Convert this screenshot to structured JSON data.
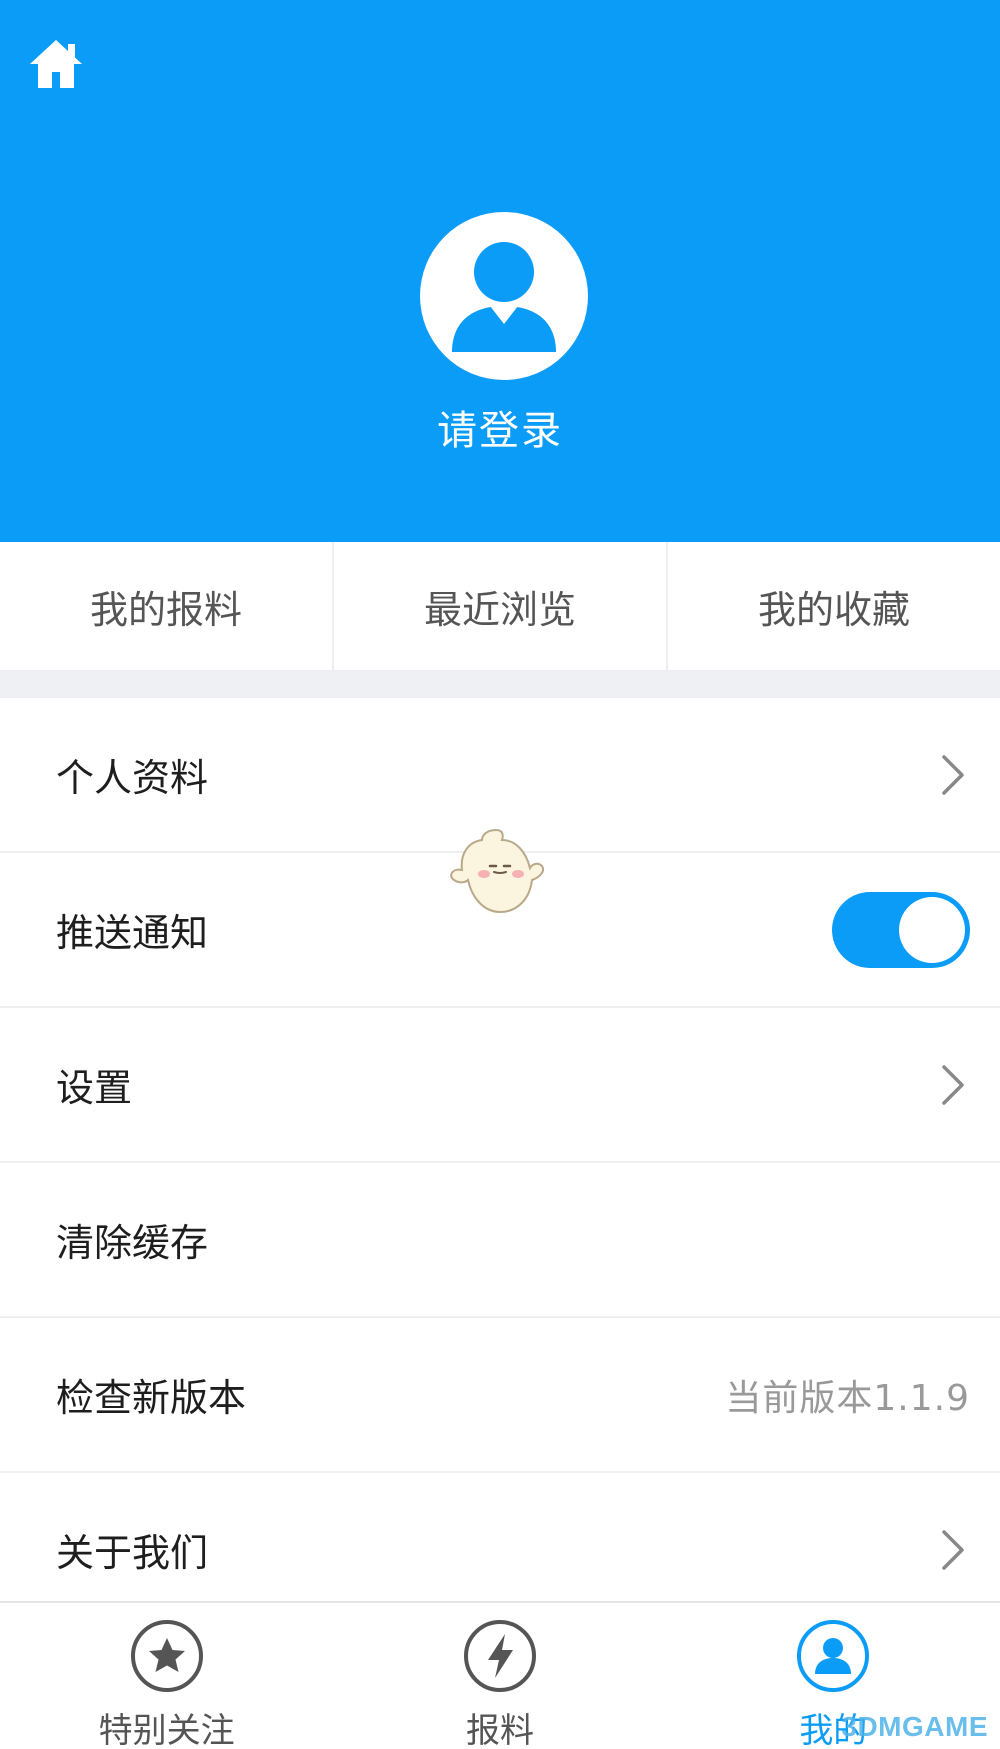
{
  "header": {
    "login_text": "请登录",
    "home_icon": "home-icon",
    "avatar_icon": "user-avatar-icon",
    "bg_color": "#0b9cf7"
  },
  "quick_tabs": [
    {
      "label": "我的报料"
    },
    {
      "label": "最近浏览"
    },
    {
      "label": "我的收藏"
    }
  ],
  "menu": {
    "profile": {
      "label": "个人资料",
      "icon": "chevron-right-icon"
    },
    "push": {
      "label": "推送通知",
      "enabled": true
    },
    "settings": {
      "label": "设置",
      "icon": "chevron-right-icon"
    },
    "clear_cache": {
      "label": "清除缓存"
    },
    "check_version": {
      "label": "检查新版本",
      "current": "当前版本1.1.9"
    },
    "about": {
      "label": "关于我们",
      "icon": "chevron-right-icon"
    }
  },
  "tabbar": [
    {
      "label": "特别关注",
      "icon": "star-icon",
      "active": false
    },
    {
      "label": "报料",
      "icon": "lightning-icon",
      "active": false
    },
    {
      "label": "我的",
      "icon": "user-icon",
      "active": true
    }
  ],
  "watermark": {
    "text": "3DMGAME"
  }
}
